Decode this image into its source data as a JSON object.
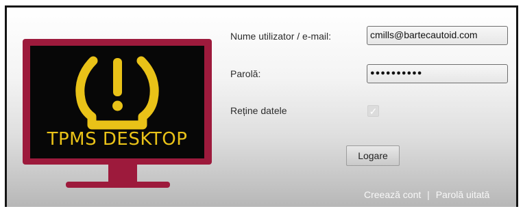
{
  "logo": {
    "text": "TPMS DESKTOP"
  },
  "login": {
    "username_label": "Nume utilizator / e-mail:",
    "username_value": "cmills@bartecautoid.com",
    "password_label": "Parolă:",
    "password_value": "●●●●●●●●●●",
    "remember_label": "Reține datele",
    "remember_checked": true,
    "remember_mark": "✓",
    "login_button": "Logare"
  },
  "footer": {
    "create_account": "Creează cont",
    "separator": "|",
    "forgot_password": "Parolă uitată"
  },
  "colors": {
    "logo_frame": "#9d1a3c",
    "logo_symbol": "#e9c218",
    "screen": "#070707"
  },
  "icons": [
    "tpms-warning-icon",
    "checkmark-icon"
  ]
}
